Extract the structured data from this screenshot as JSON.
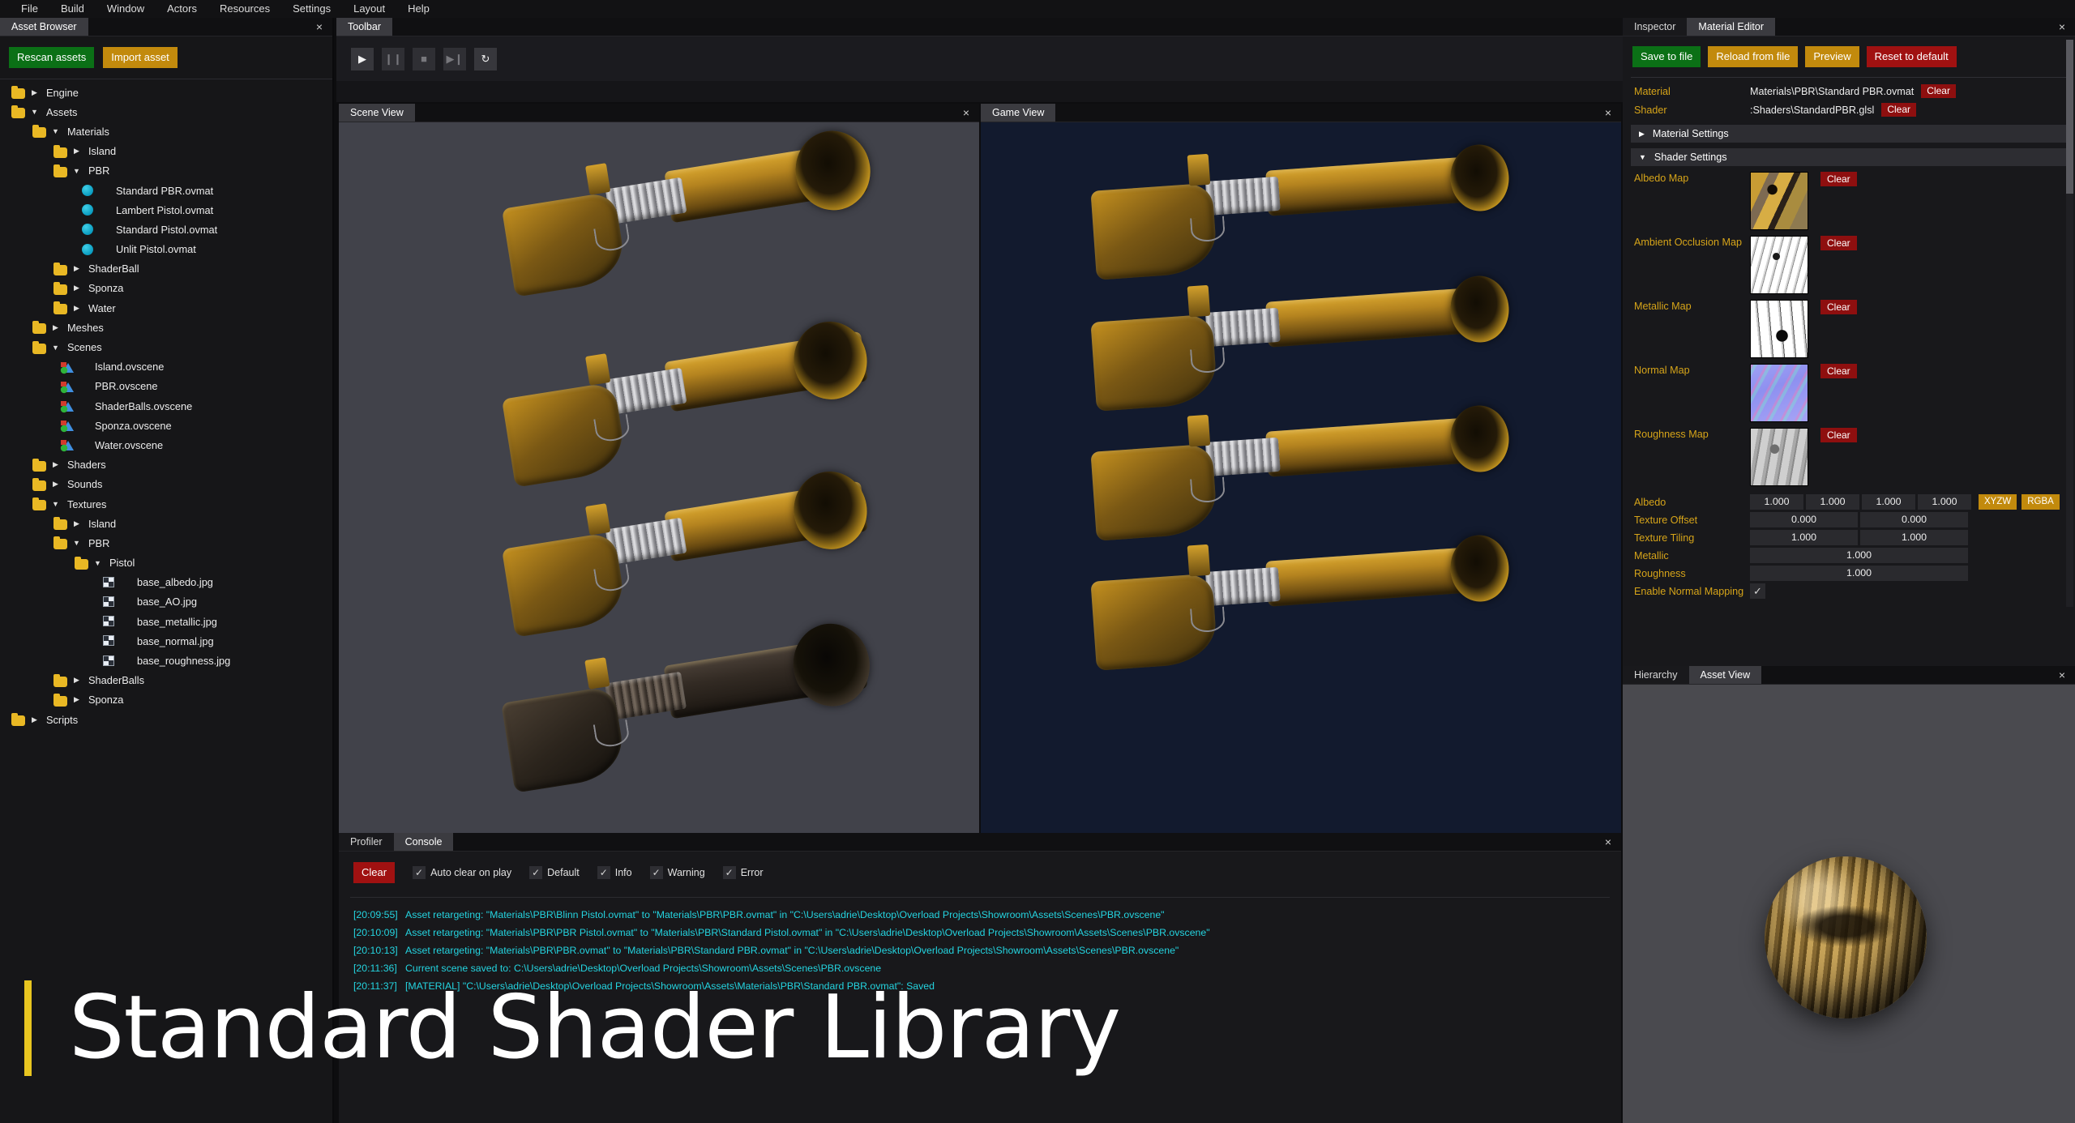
{
  "menu": {
    "items": [
      "File",
      "Build",
      "Window",
      "Actors",
      "Resources",
      "Settings",
      "Layout",
      "Help"
    ]
  },
  "asset_browser": {
    "tab_label": "Asset Browser",
    "close_icon": "×",
    "rescan_label": "Rescan assets",
    "import_label": "Import asset",
    "tree": [
      {
        "label": "Engine",
        "type": "folder",
        "depth": 0,
        "state": "collapsed"
      },
      {
        "label": "Assets",
        "type": "folder",
        "depth": 0,
        "state": "expanded"
      },
      {
        "label": "Materials",
        "type": "folder",
        "depth": 1,
        "state": "expanded"
      },
      {
        "label": "Island",
        "type": "folder",
        "depth": 2,
        "state": "collapsed"
      },
      {
        "label": "PBR",
        "type": "folder",
        "depth": 2,
        "state": "expanded"
      },
      {
        "label": "Standard PBR.ovmat",
        "type": "material",
        "depth": 3,
        "state": "leaf"
      },
      {
        "label": "Lambert Pistol.ovmat",
        "type": "material",
        "depth": 3,
        "state": "leaf"
      },
      {
        "label": "Standard Pistol.ovmat",
        "type": "material",
        "depth": 3,
        "state": "leaf"
      },
      {
        "label": "Unlit Pistol.ovmat",
        "type": "material",
        "depth": 3,
        "state": "leaf"
      },
      {
        "label": "ShaderBall",
        "type": "folder",
        "depth": 2,
        "state": "collapsed"
      },
      {
        "label": "Sponza",
        "type": "folder",
        "depth": 2,
        "state": "collapsed"
      },
      {
        "label": "Water",
        "type": "folder",
        "depth": 2,
        "state": "collapsed"
      },
      {
        "label": "Meshes",
        "type": "folder",
        "depth": 1,
        "state": "collapsed"
      },
      {
        "label": "Scenes",
        "type": "folder",
        "depth": 1,
        "state": "expanded"
      },
      {
        "label": "Island.ovscene",
        "type": "scene",
        "depth": 2,
        "state": "leaf"
      },
      {
        "label": "PBR.ovscene",
        "type": "scene",
        "depth": 2,
        "state": "leaf"
      },
      {
        "label": "ShaderBalls.ovscene",
        "type": "scene",
        "depth": 2,
        "state": "leaf"
      },
      {
        "label": "Sponza.ovscene",
        "type": "scene",
        "depth": 2,
        "state": "leaf"
      },
      {
        "label": "Water.ovscene",
        "type": "scene",
        "depth": 2,
        "state": "leaf"
      },
      {
        "label": "Shaders",
        "type": "folder",
        "depth": 1,
        "state": "collapsed"
      },
      {
        "label": "Sounds",
        "type": "folder",
        "depth": 1,
        "state": "collapsed"
      },
      {
        "label": "Textures",
        "type": "folder",
        "depth": 1,
        "state": "expanded"
      },
      {
        "label": "Island",
        "type": "folder",
        "depth": 2,
        "state": "collapsed"
      },
      {
        "label": "PBR",
        "type": "folder",
        "depth": 2,
        "state": "expanded"
      },
      {
        "label": "Pistol",
        "type": "folder",
        "depth": 3,
        "state": "expanded"
      },
      {
        "label": "base_albedo.jpg",
        "type": "texture",
        "depth": 4,
        "state": "leaf"
      },
      {
        "label": "base_AO.jpg",
        "type": "texture",
        "depth": 4,
        "state": "leaf"
      },
      {
        "label": "base_metallic.jpg",
        "type": "texture",
        "depth": 4,
        "state": "leaf"
      },
      {
        "label": "base_normal.jpg",
        "type": "texture",
        "depth": 4,
        "state": "leaf"
      },
      {
        "label": "base_roughness.jpg",
        "type": "texture",
        "depth": 4,
        "state": "leaf"
      },
      {
        "label": "ShaderBalls",
        "type": "folder",
        "depth": 2,
        "state": "collapsed"
      },
      {
        "label": "Sponza",
        "type": "folder",
        "depth": 2,
        "state": "collapsed"
      },
      {
        "label": "Scripts",
        "type": "folder",
        "depth": 0,
        "state": "collapsed"
      }
    ]
  },
  "toolbar": {
    "tab_label": "Toolbar",
    "close_icon": "×",
    "buttons": [
      {
        "name": "play-button",
        "glyph": "▶",
        "enabled": true
      },
      {
        "name": "pause-button",
        "glyph": "❙❙",
        "enabled": false
      },
      {
        "name": "stop-button",
        "glyph": "■",
        "enabled": false
      },
      {
        "name": "next-frame-button",
        "glyph": "▶❙",
        "enabled": false
      },
      {
        "name": "refresh-button",
        "glyph": "↻",
        "enabled": true
      }
    ]
  },
  "scene_view": {
    "tab_label": "Scene View",
    "close_icon": "×"
  },
  "game_view": {
    "tab_label": "Game View",
    "close_icon": "×"
  },
  "console": {
    "tabs": [
      {
        "label": "Profiler",
        "active": false
      },
      {
        "label": "Console",
        "active": true
      }
    ],
    "close_icon": "×",
    "clear_label": "Clear",
    "filters": [
      {
        "label": "Auto clear on play",
        "checked": true
      },
      {
        "label": "Default",
        "checked": true
      },
      {
        "label": "Info",
        "checked": true
      },
      {
        "label": "Warning",
        "checked": true
      },
      {
        "label": "Error",
        "checked": true
      }
    ],
    "check_glyph": "✓",
    "logs": [
      {
        "time": "[20:09:55]",
        "message": "Asset retargeting: \"Materials\\PBR\\Blinn Pistol.ovmat\" to \"Materials\\PBR\\PBR.ovmat\" in \"C:\\Users\\adrie\\Desktop\\Overload Projects\\Showroom\\Assets\\Scenes\\PBR.ovscene\""
      },
      {
        "time": "[20:10:09]",
        "message": "Asset retargeting: \"Materials\\PBR\\PBR Pistol.ovmat\" to \"Materials\\PBR\\Standard Pistol.ovmat\" in \"C:\\Users\\adrie\\Desktop\\Overload Projects\\Showroom\\Assets\\Scenes\\PBR.ovscene\""
      },
      {
        "time": "[20:10:13]",
        "message": "Asset retargeting: \"Materials\\PBR\\PBR.ovmat\" to \"Materials\\PBR\\Standard PBR.ovmat\" in \"C:\\Users\\adrie\\Desktop\\Overload Projects\\Showroom\\Assets\\Scenes\\PBR.ovscene\""
      },
      {
        "time": "[20:11:36]",
        "message": "Current scene saved to: C:\\Users\\adrie\\Desktop\\Overload Projects\\Showroom\\Assets\\Scenes\\PBR.ovscene"
      },
      {
        "time": "[20:11:37]",
        "message": "[MATERIAL] \"C:\\Users\\adrie\\Desktop\\Overload Projects\\Showroom\\Assets\\Materials\\PBR\\Standard PBR.ovmat\": Saved"
      }
    ]
  },
  "inspector": {
    "tabs": [
      {
        "label": "Inspector",
        "active": false
      },
      {
        "label": "Material Editor",
        "active": true
      }
    ],
    "close_icon": "×",
    "actions": [
      {
        "label": "Save to file",
        "style": "green"
      },
      {
        "label": "Reload from file",
        "style": "amber"
      },
      {
        "label": "Preview",
        "style": "amber"
      },
      {
        "label": "Reset to default",
        "style": "red"
      }
    ],
    "material_label": "Material",
    "material_value": "Materials\\PBR\\Standard PBR.ovmat",
    "material_clear": "Clear",
    "shader_label": "Shader",
    "shader_value": ":Shaders\\StandardPBR.glsl",
    "shader_clear": "Clear",
    "material_settings_label": "Material Settings",
    "material_settings_arrow": "▶",
    "shader_settings_label": "Shader Settings",
    "shader_settings_arrow": "▼",
    "maps": [
      {
        "label": "Albedo Map",
        "clear": "Clear",
        "thumb": "th-albedo"
      },
      {
        "label": "Ambient Occlusion Map",
        "clear": "Clear",
        "thumb": "th-ao"
      },
      {
        "label": "Metallic Map",
        "clear": "Clear",
        "thumb": "th-metallic"
      },
      {
        "label": "Normal Map",
        "clear": "Clear",
        "thumb": "th-normal"
      },
      {
        "label": "Roughness Map",
        "clear": "Clear",
        "thumb": "th-rough"
      }
    ],
    "albedo_label": "Albedo",
    "albedo_values": [
      "1.000",
      "1.000",
      "1.000",
      "1.000"
    ],
    "xyzw_label": "XYZW",
    "rgba_label": "RGBA",
    "texture_offset_label": "Texture Offset",
    "texture_offset_values": [
      "0.000",
      "0.000"
    ],
    "texture_tiling_label": "Texture Tiling",
    "texture_tiling_values": [
      "1.000",
      "1.000"
    ],
    "metallic_label": "Metallic",
    "metallic_value": "1.000",
    "roughness_label": "Roughness",
    "roughness_value": "1.000",
    "enable_normal_mapping_label": "Enable Normal Mapping",
    "enable_normal_mapping_checked": true,
    "check_glyph": "✓"
  },
  "asset_view": {
    "tabs": [
      {
        "label": "Hierarchy",
        "active": false
      },
      {
        "label": "Asset View",
        "active": true
      }
    ],
    "close_icon": "×"
  },
  "overlay_title": "Standard Shader Library",
  "colors": {
    "accent_yellow": "#e8c520",
    "label_gold": "#d6a419",
    "green": "#0b7016",
    "amber": "#c28a0d",
    "red": "#a01111",
    "dark_red": "#8e0f0f",
    "log_cyan": "#24d4e0",
    "material_icon": "#0a9cc0",
    "folder": "#e9b824"
  }
}
